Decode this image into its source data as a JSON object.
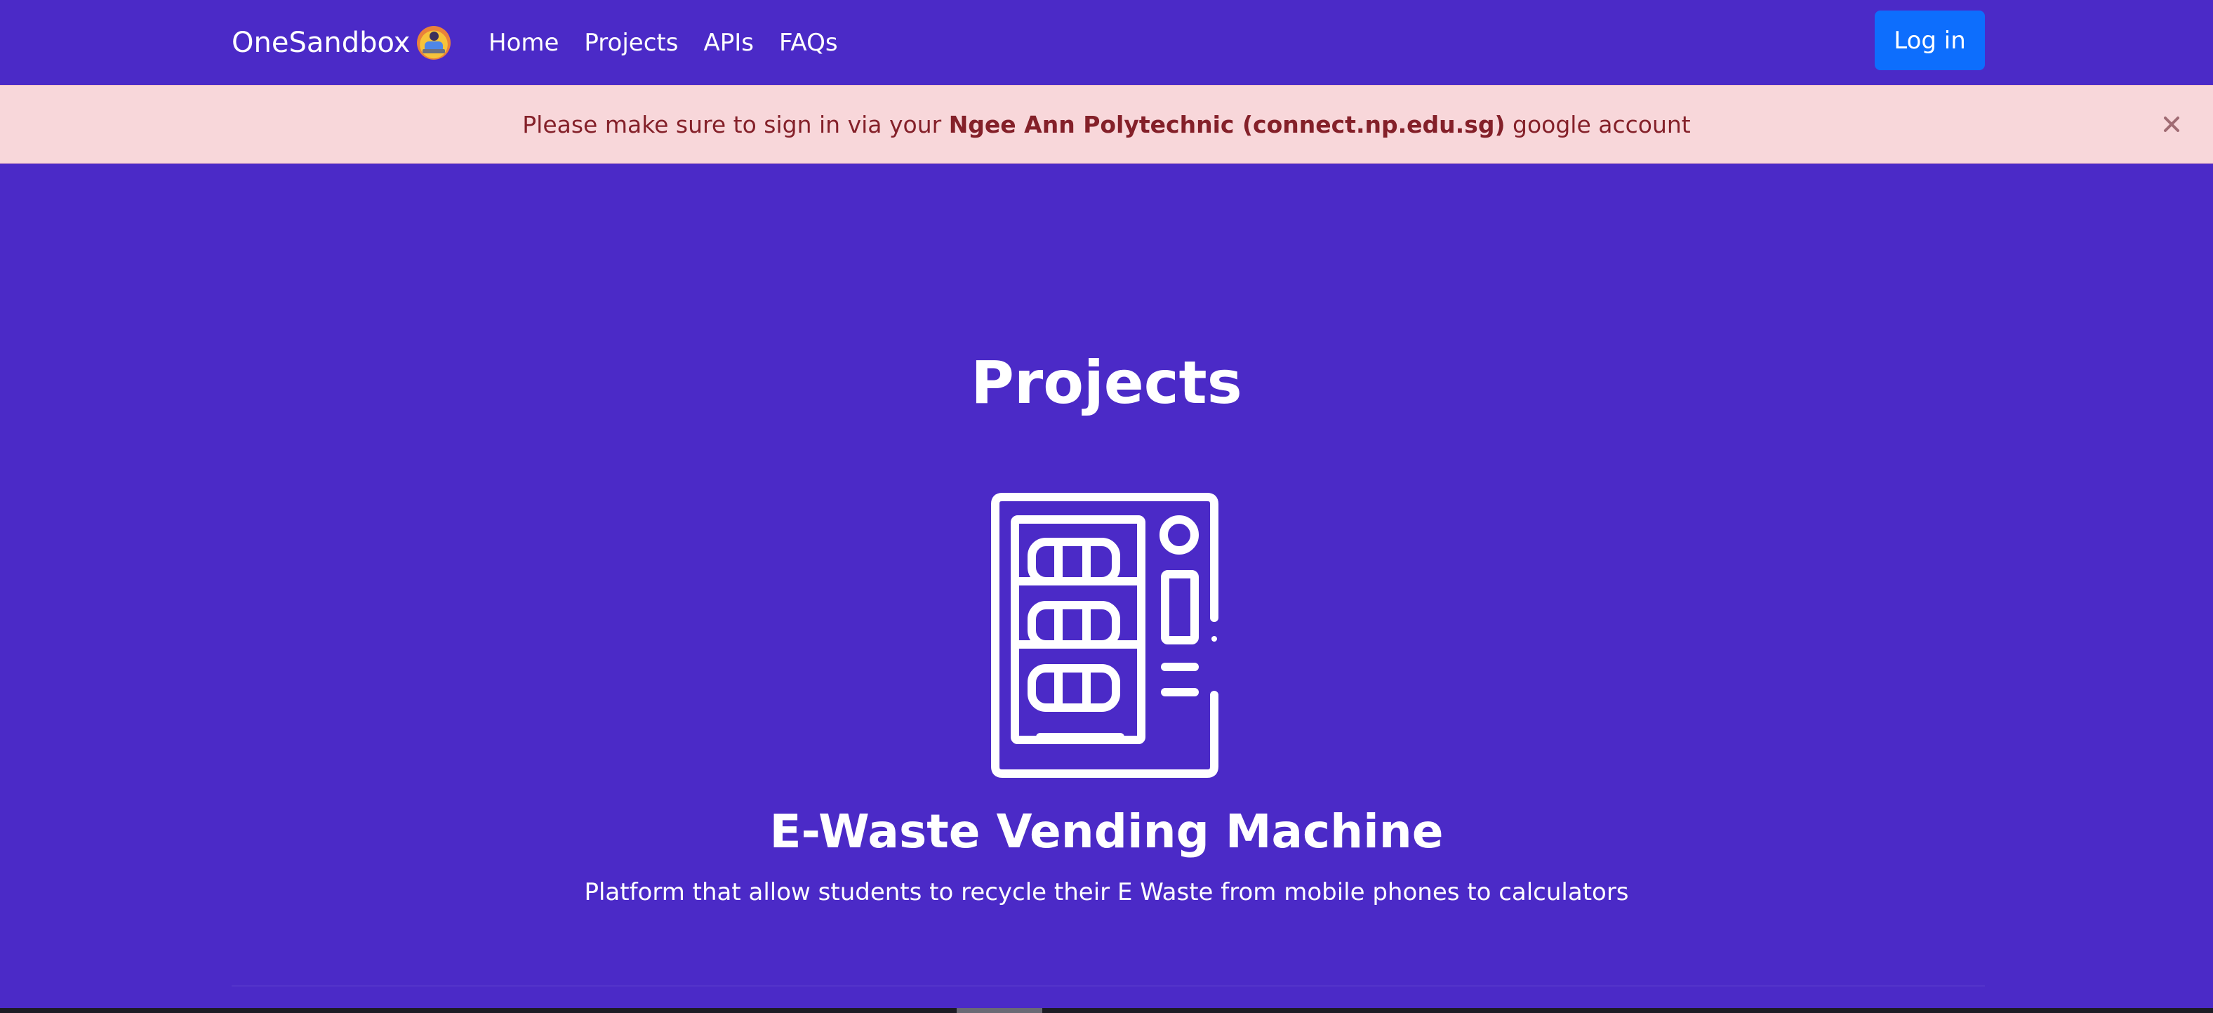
{
  "navbar": {
    "brand": "OneSandbox",
    "links": [
      "Home",
      "Projects",
      "APIs",
      "FAQs"
    ],
    "login_label": "Log in",
    "brand_logo_icon": "person-at-laptop-logo",
    "accent_color": "#0d6efd",
    "background_color": "#4b2ac7"
  },
  "alert": {
    "prefix": "Please make sure to sign in via your ",
    "emphasis": "Ngee Ann Polytechnic (connect.np.edu.sg)",
    "suffix": " google account",
    "close_icon": "close-icon",
    "background_color": "#f8d7da",
    "text_color": "#842029"
  },
  "main": {
    "title": "Projects",
    "project": {
      "icon": "vending-machine-icon",
      "title": "E-Waste Vending Machine",
      "description": "Platform that allow students to recycle their E Waste from mobile phones to calculators"
    }
  }
}
